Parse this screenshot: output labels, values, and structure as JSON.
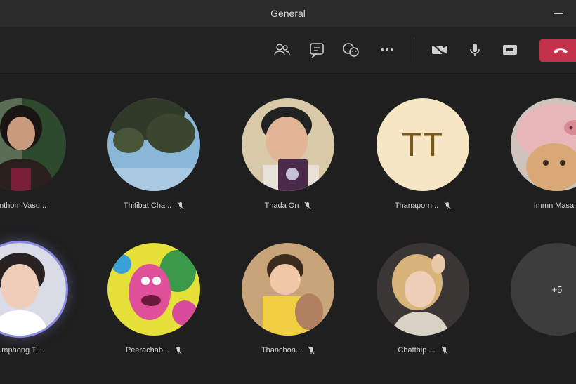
{
  "window": {
    "title": "General"
  },
  "toolbar": {
    "buttons": [
      {
        "id": "participants",
        "icon": "people-icon"
      },
      {
        "id": "chat",
        "icon": "chat-icon"
      },
      {
        "id": "reactions",
        "icon": "reactions-icon"
      },
      {
        "id": "more",
        "icon": "more-options-icon"
      },
      {
        "id": "camera",
        "icon": "camera-icon"
      },
      {
        "id": "mic",
        "icon": "microphone-icon"
      },
      {
        "id": "share",
        "icon": "share-screen-icon"
      },
      {
        "id": "leave",
        "icon": "phone-hangup-icon"
      }
    ],
    "leave_color": "#c4314b"
  },
  "participants": [
    {
      "name": "...nthom Vasu...",
      "muted": false,
      "avatar": "photo-woman-dark-hair"
    },
    {
      "name": "Thitibat Cha...",
      "muted": true,
      "avatar": "photo-tree-sky"
    },
    {
      "name": "Thada On",
      "muted": true,
      "avatar": "photo-man-camera"
    },
    {
      "name": "Thanaporn...",
      "muted": true,
      "avatar": "initials",
      "initials": "TT"
    },
    {
      "name": "Immn Masa...",
      "muted": false,
      "avatar": "photo-cat-pig-hat"
    },
    {
      "name": "...mphong Ti...",
      "muted": false,
      "avatar": "photo-young-man",
      "speaking": true
    },
    {
      "name": "Peerachab...",
      "muted": true,
      "avatar": "photo-troll-doll"
    },
    {
      "name": "Thanchon...",
      "muted": true,
      "avatar": "photo-child-yellow"
    },
    {
      "name": "Chatthip ...",
      "muted": true,
      "avatar": "photo-woman-blonde"
    },
    {
      "name": "",
      "muted": false,
      "avatar": "overflow",
      "overflow_label": "+5"
    }
  ]
}
